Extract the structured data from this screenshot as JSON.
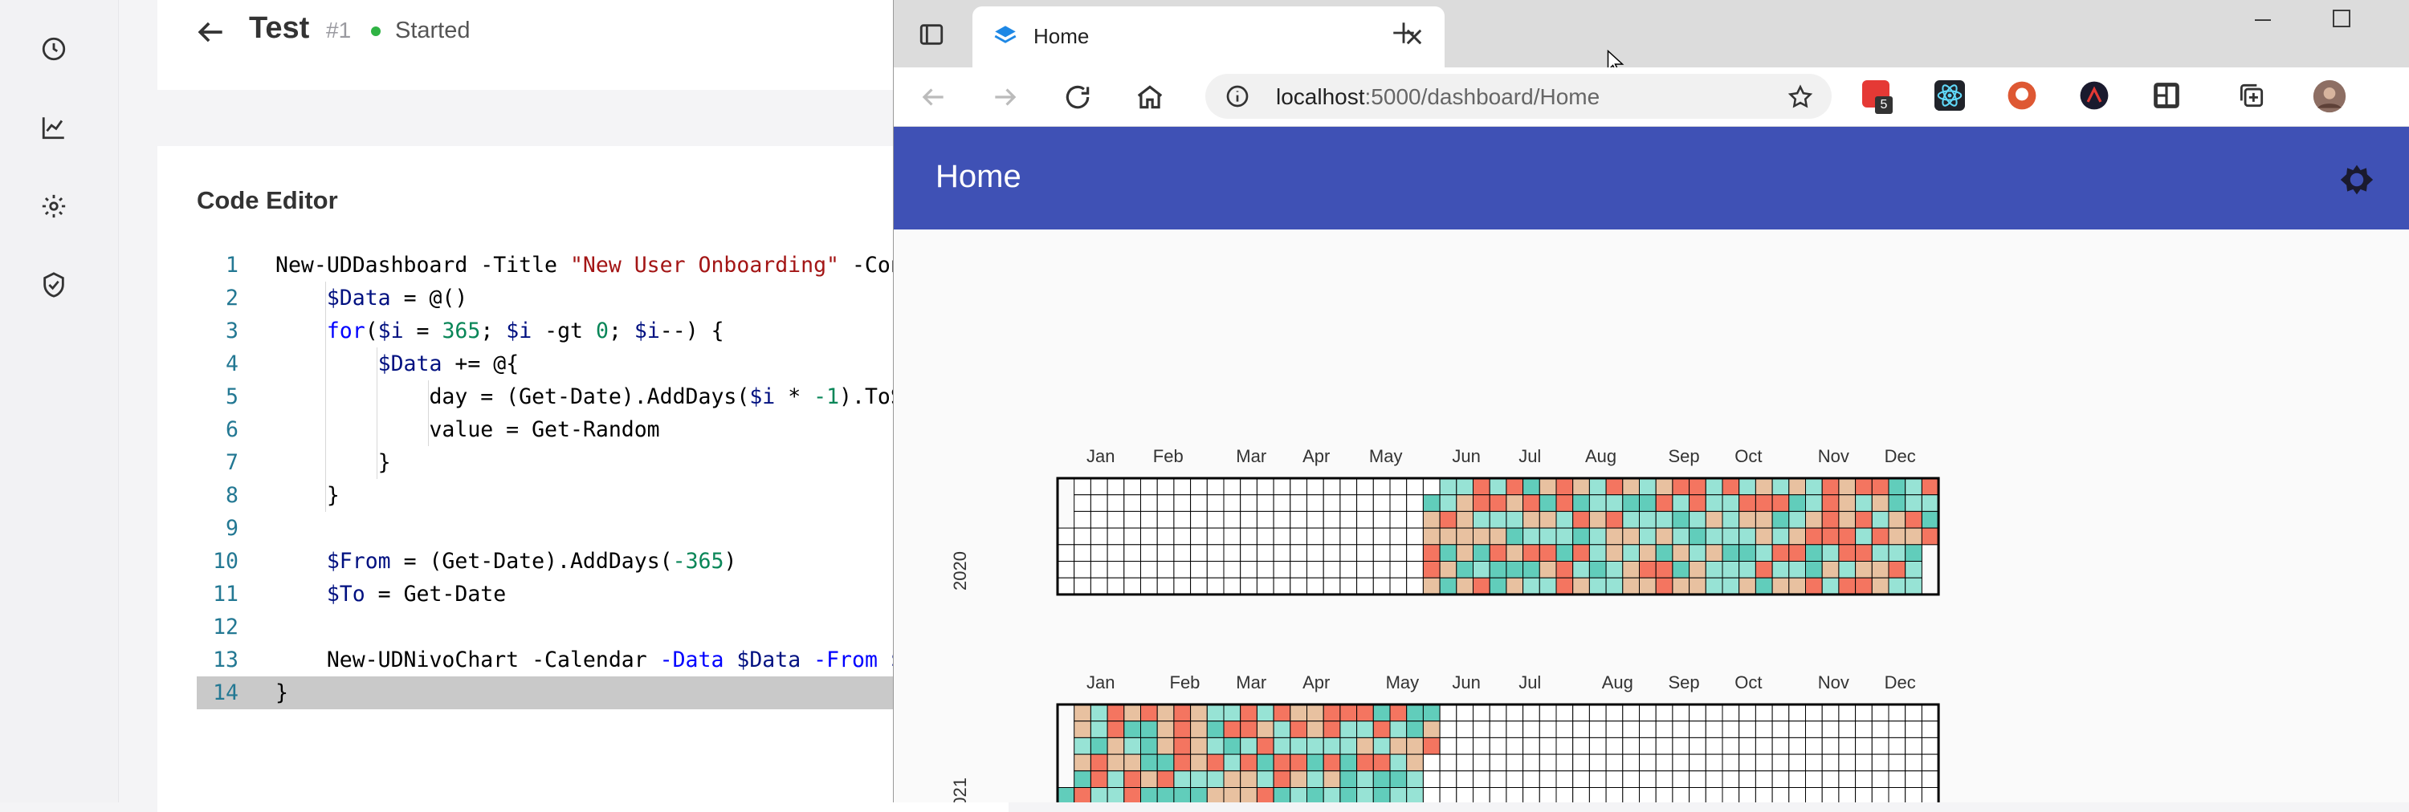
{
  "header": {
    "title": "Test",
    "run_number": "#1",
    "status": "Started",
    "status_color": "#2fb344"
  },
  "editor": {
    "title": "Code Editor",
    "active_line": 14,
    "lines": [
      {
        "n": "1",
        "tokens": [
          [
            "p",
            "New-UDDashboard -Title "
          ],
          [
            "s",
            "\"New User Onboarding\""
          ],
          [
            "p",
            " -Cont"
          ]
        ]
      },
      {
        "n": "2",
        "tokens": [
          [
            "p",
            "    "
          ],
          [
            "v",
            "$Data"
          ],
          [
            "p",
            " = @()"
          ]
        ]
      },
      {
        "n": "3",
        "tokens": [
          [
            "p",
            "    "
          ],
          [
            "k",
            "for"
          ],
          [
            "p",
            "("
          ],
          [
            "v",
            "$i"
          ],
          [
            "p",
            " = "
          ],
          [
            "n",
            "365"
          ],
          [
            "p",
            "; "
          ],
          [
            "v",
            "$i"
          ],
          [
            "p",
            " -gt "
          ],
          [
            "n",
            "0"
          ],
          [
            "p",
            "; "
          ],
          [
            "v",
            "$i"
          ],
          [
            "p",
            "--) {"
          ]
        ]
      },
      {
        "n": "4",
        "tokens": [
          [
            "p",
            "        "
          ],
          [
            "v",
            "$Data"
          ],
          [
            "p",
            " += @{"
          ]
        ]
      },
      {
        "n": "5",
        "tokens": [
          [
            "p",
            "            day = (Get-Date).AddDays("
          ],
          [
            "v",
            "$i"
          ],
          [
            "p",
            " * "
          ],
          [
            "n",
            "-1"
          ],
          [
            "p",
            ").ToSt"
          ]
        ]
      },
      {
        "n": "6",
        "tokens": [
          [
            "p",
            "            value = Get-Random"
          ]
        ]
      },
      {
        "n": "7",
        "tokens": [
          [
            "p",
            "        }"
          ]
        ]
      },
      {
        "n": "8",
        "tokens": [
          [
            "p",
            "    }"
          ]
        ]
      },
      {
        "n": "9",
        "tokens": []
      },
      {
        "n": "10",
        "tokens": [
          [
            "p",
            "    "
          ],
          [
            "v",
            "$From"
          ],
          [
            "p",
            " = (Get-Date).AddDays("
          ],
          [
            "n",
            "-365"
          ],
          [
            "p",
            ")"
          ]
        ]
      },
      {
        "n": "11",
        "tokens": [
          [
            "p",
            "    "
          ],
          [
            "v",
            "$To"
          ],
          [
            "p",
            " = Get-Date"
          ]
        ]
      },
      {
        "n": "12",
        "tokens": []
      },
      {
        "n": "13",
        "tokens": [
          [
            "p",
            "    New-UDNivoChart -Calendar "
          ],
          [
            "k",
            "-Data"
          ],
          [
            "p",
            " "
          ],
          [
            "v",
            "$Data"
          ],
          [
            "p",
            " "
          ],
          [
            "k",
            "-From"
          ],
          [
            "p",
            " "
          ],
          [
            "v",
            "$F"
          ]
        ]
      },
      {
        "n": "14",
        "tokens": [
          [
            "p",
            "}"
          ]
        ]
      }
    ]
  },
  "sidebar": {
    "icons": [
      "history-icon",
      "chart-icon",
      "settings-icon",
      "shield-check-icon"
    ]
  },
  "browser": {
    "tab_title": "Home",
    "url_host": "localhost",
    "url_path": ":5000/dashboard/Home",
    "extension_badge": "5",
    "app_title": "Home",
    "app_bar_color": "#3f51b5"
  },
  "calendar": {
    "years": [
      "2020",
      "2021"
    ],
    "months": [
      "Jan",
      "Feb",
      "Mar",
      "Apr",
      "May",
      "Jun",
      "Jul",
      "Aug",
      "Sep",
      "Oct",
      "Nov",
      "Dec"
    ],
    "colors": [
      "#61cdbb",
      "#97e3d5",
      "#e8c1a0",
      "#f47560"
    ],
    "empty_color": "#ffffff",
    "filled_2020": "Jun-Dec",
    "filled_2021": "Jan-May"
  }
}
